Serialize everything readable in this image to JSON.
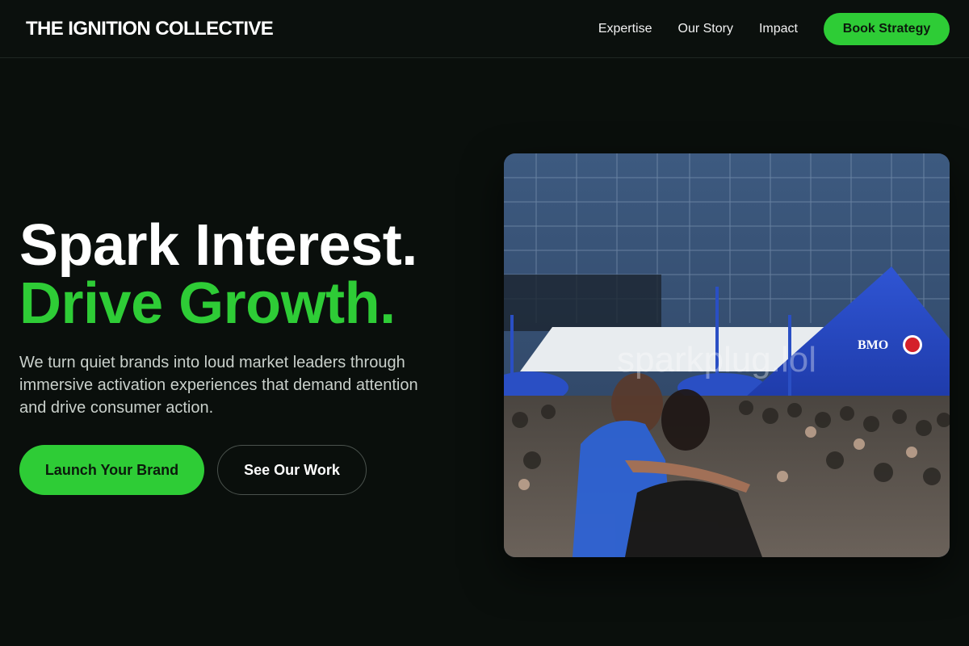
{
  "header": {
    "brand": "THE IGNITION COLLECTIVE",
    "nav": [
      {
        "label": "Expertise"
      },
      {
        "label": "Our Story"
      },
      {
        "label": "Impact"
      }
    ],
    "cta_label": "Book Strategy"
  },
  "hero": {
    "title_line1": "Spark Interest.",
    "title_line2": "Drive Growth.",
    "subtitle": "We turn quiet brands into loud market leaders through immersive activation experiences that demand attention and drive consumer action.",
    "primary_button": "Launch Your Brand",
    "secondary_button": "See Our Work",
    "image": {
      "tent_logo_text": "BMO",
      "watermark": "sparkplug.lol"
    }
  },
  "colors": {
    "accent": "#2ecc36",
    "background": "#0a0f0c",
    "text": "#ffffff",
    "muted_text": "#c9d0cb"
  }
}
